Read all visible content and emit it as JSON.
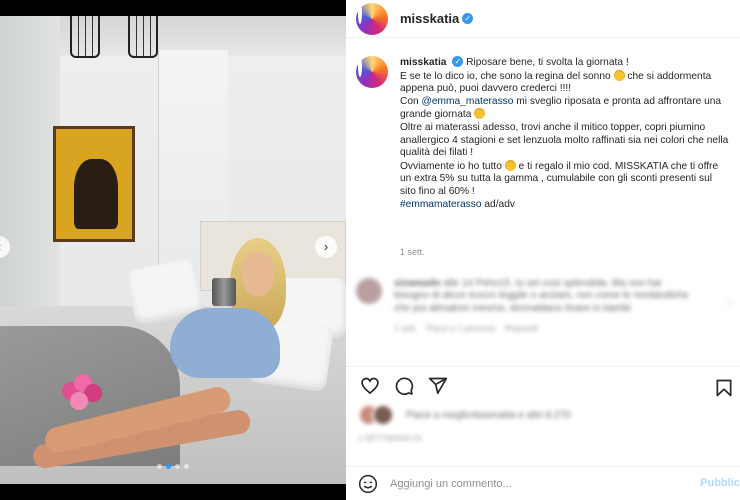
{
  "post": {
    "username": "misskatia",
    "verified_icon": "verified-badge-icon"
  },
  "photo": {
    "nav_next_icon": "chevron-right-icon",
    "nav_prev_icon": "chevron-left-icon",
    "slide_count": 4,
    "active_slide": 2
  },
  "caption": {
    "username": "misskatia",
    "line1": "Riposare bene, ti svolta la giornata !",
    "line2a": "E se te lo dico io, che sono la regina del sonno",
    "line2b": "che si addormenta appena può, puoi davvero crederci !!!!",
    "line3a": "Con",
    "mention": "@emma_materasso",
    "line3b": "mi sveglio riposata e pronta ad affrontare una grande giornata",
    "line4": "Oltre ai materassi adesso, trovi anche il mitico topper, copri piumino anallergico 4 stagioni e set lenzuola molto raffinati sia nei colori che nella qualità dei filati !",
    "line5a": "Ovviamente io ho tutto",
    "line5b": "e ti regalo il mio cod. MISSKATIA che ti offre un extra 5% su tutta la gamma , cumulabile con gli sconti presenti sul sito fino al 60% !",
    "hashtag": "#emmamaterasso",
    "tag_suffix": "ad/adv",
    "timestamp": "1 sett."
  },
  "comment": {
    "author": "sinamado",
    "text": "alle 14 Peho15. tu sei così splendida. Ma non hai bisogno di alcun trucco leggile o anziani, non come le nordandiche che poi alimalore inesme, donnaldano itnare io bambi",
    "meta_time": "1 sett.",
    "meta_likes": "Piace a 1 persona",
    "meta_reply": "Rispondi"
  },
  "actions": {
    "like_icon": "heart-icon",
    "comment_icon": "comment-icon",
    "share_icon": "share-icon",
    "save_icon": "bookmark-icon"
  },
  "likes": {
    "text": "Piace a meglio4asenatta e altri 8.270",
    "time": "1 SETTIMANA FA"
  },
  "comment_box": {
    "emoji_icon": "smiley-icon",
    "placeholder": "Aggiungi un commento...",
    "publish_label": "Pubblica"
  }
}
